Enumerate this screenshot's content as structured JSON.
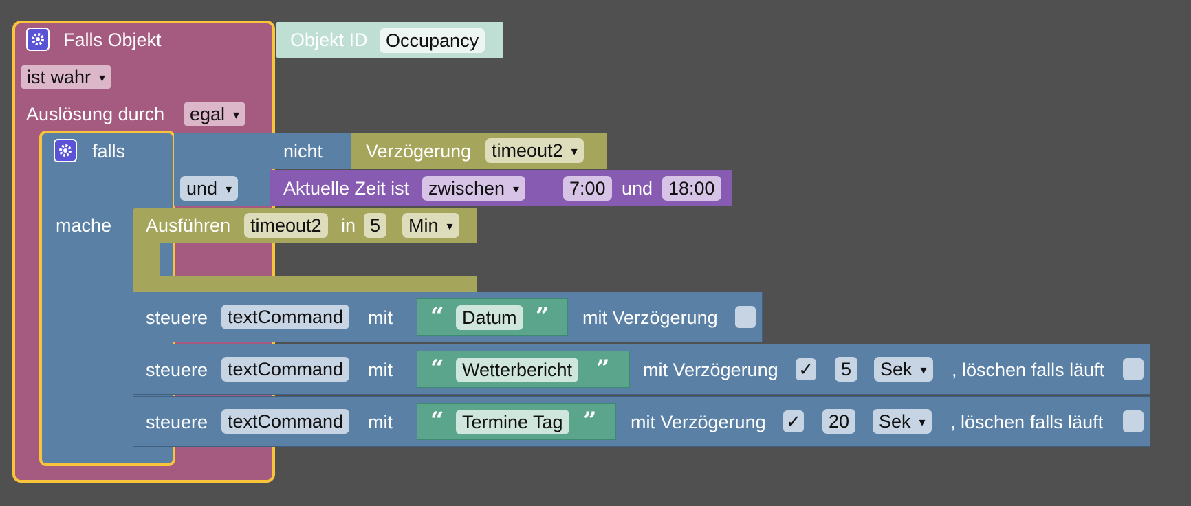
{
  "trigger": {
    "title": "Falls Objekt",
    "object_id_label": "Objekt ID",
    "object_id_value": "Occupancy",
    "condition": "ist wahr",
    "trigger_by_label": "Auslösung durch",
    "trigger_by_value": "egal"
  },
  "if_block": {
    "falls_label": "falls",
    "mache_label": "mache",
    "not_label": "nicht",
    "delay_label": "Verzögerung",
    "delay_value": "timeout2",
    "and_op": "und",
    "time_label": "Aktuelle Zeit ist",
    "time_mode": "zwischen",
    "time_from": "7:00",
    "time_and": "und",
    "time_to": "18:00"
  },
  "timeout": {
    "label": "Ausführen",
    "name": "timeout2",
    "in_label": "in",
    "value": "5",
    "unit": "Min"
  },
  "commands": [
    {
      "steuere": "steuere",
      "target": "textCommand",
      "mit": "mit",
      "text": "Datum",
      "delay_label": "mit Verzögerung",
      "delay_checked": "",
      "delay_value": "",
      "delay_unit": "",
      "clear_label": ""
    },
    {
      "steuere": "steuere",
      "target": "textCommand",
      "mit": "mit",
      "text": "Wetterbericht",
      "delay_label": "mit Verzögerung",
      "delay_checked": "✓",
      "delay_value": "5",
      "delay_unit": "Sek",
      "clear_label": ", löschen falls läuft"
    },
    {
      "steuere": "steuere",
      "target": "textCommand",
      "mit": "mit",
      "text": "Termine Tag",
      "delay_label": "mit Verzögerung",
      "delay_checked": "✓",
      "delay_value": "20",
      "delay_unit": "Sek",
      "clear_label": ", löschen falls läuft"
    }
  ],
  "colors": {
    "workspace": "#505050",
    "trigger": "#a55b80",
    "logic": "#5b80a5",
    "timeout": "#a5a55b",
    "time": "#885bb3",
    "text": "#5ba58c",
    "selected_outline": "#f9c33a"
  }
}
